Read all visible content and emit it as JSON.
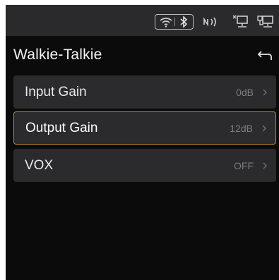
{
  "status_bar": {
    "icons": [
      "wifi-icon",
      "bluetooth-icon",
      "nfc-icon",
      "network-disconnected-icon",
      "network-icon"
    ]
  },
  "header": {
    "title": "Walkie-Talkie",
    "back_icon": "back-arrow-icon"
  },
  "settings": [
    {
      "label": "Input Gain",
      "value": "0dB",
      "selected": false
    },
    {
      "label": "Output Gain",
      "value": "12dB",
      "selected": true
    },
    {
      "label": "VOX",
      "value": "OFF",
      "selected": false
    }
  ],
  "colors": {
    "background": "#0b0b0b",
    "status_bar": "#2a2a2c",
    "row": "#2b2b2d",
    "selection_border": "#b9852f",
    "value_text": "#7c7c7c"
  }
}
